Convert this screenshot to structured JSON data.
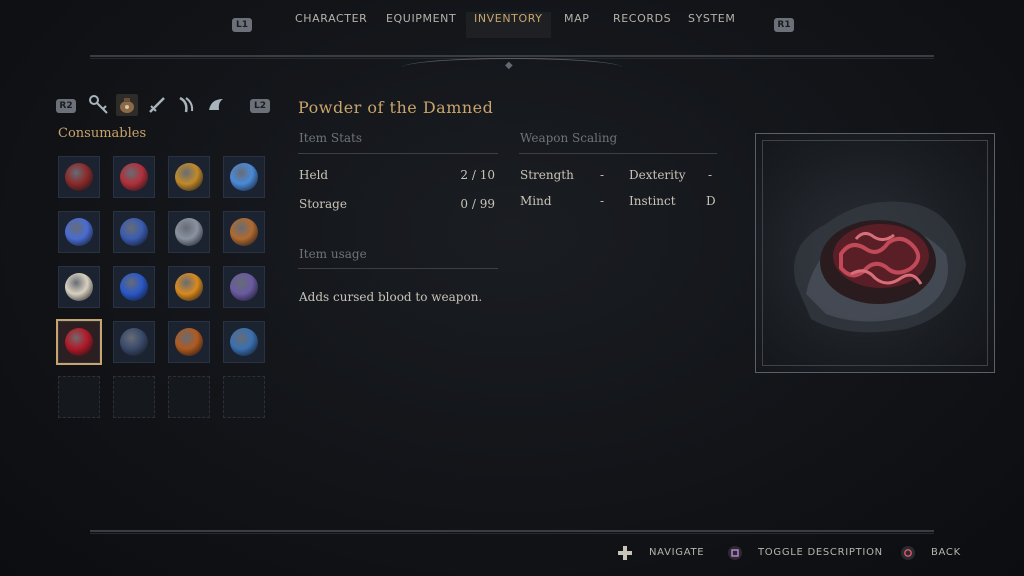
{
  "nav": {
    "left_shoulder": "L1",
    "right_shoulder": "R1",
    "tabs": [
      {
        "label": "CHARACTER"
      },
      {
        "label": "EQUIPMENT"
      },
      {
        "label": "INVENTORY"
      },
      {
        "label": "MAP"
      },
      {
        "label": "RECORDS"
      },
      {
        "label": "SYSTEM"
      }
    ],
    "active_tab": "INVENTORY"
  },
  "filters": {
    "left_button": "R2",
    "right_button": "L2",
    "icons": [
      "key-icon",
      "pouch-icon",
      "dagger-icon",
      "claw-icon",
      "horn-icon"
    ],
    "selected": "pouch-icon"
  },
  "category": "Consumables",
  "grid": {
    "slots": [
      {
        "icon": "red-blade-icon",
        "color": "#8a2a2a"
      },
      {
        "icon": "red-vial-icon",
        "color": "#b0303a"
      },
      {
        "icon": "amber-jar-icon",
        "color": "#c08a2a"
      },
      {
        "icon": "blue-crystal-icon",
        "color": "#4a8ad8"
      },
      {
        "icon": "blue-shard-cluster-icon",
        "color": "#4a6cd0"
      },
      {
        "icon": "blue-ore-icon",
        "color": "#3a5cb0"
      },
      {
        "icon": "gray-bundle-icon",
        "color": "#8a92a0"
      },
      {
        "icon": "orange-bundle-icon",
        "color": "#b06a30"
      },
      {
        "icon": "bone-pile-icon",
        "color": "#d8d0c0"
      },
      {
        "icon": "blue-gem-icon",
        "color": "#2a58c8"
      },
      {
        "icon": "fire-orb-icon",
        "color": "#d88a20"
      },
      {
        "icon": "violet-orb-icon",
        "color": "#6a5aa0"
      },
      {
        "icon": "blood-powder-icon",
        "color": "#b01a28"
      },
      {
        "icon": "blue-flask-icon",
        "color": "#3a4a6a"
      },
      {
        "icon": "ember-flask-icon",
        "color": "#b05a20"
      },
      {
        "icon": "azure-flask-icon",
        "color": "#3a70b0"
      }
    ],
    "selected_index": 12,
    "empty_slots": 4
  },
  "item": {
    "name": "Powder of the Damned",
    "stats_header": "Item Stats",
    "held_label": "Held",
    "held_value": "2 / 10",
    "storage_label": "Storage",
    "storage_value": "0 / 99",
    "usage_header": "Item usage",
    "usage_text": "Adds cursed blood to weapon.",
    "scaling_header": "Weapon Scaling",
    "scaling": {
      "strength_label": "Strength",
      "strength_value": "-",
      "dexterity_label": "Dexterity",
      "dexterity_value": "-",
      "mind_label": "Mind",
      "mind_value": "-",
      "instinct_label": "Instinct",
      "instinct_value": "D"
    },
    "preview_icon": "blood-powder-icon"
  },
  "footer": {
    "navigate": "NAVIGATE",
    "toggle": "TOGGLE DESCRIPTION",
    "back": "BACK"
  },
  "colors": {
    "accent_gold": "#c9a46b",
    "text": "#c9c4b8",
    "muted": "#6e747c"
  }
}
